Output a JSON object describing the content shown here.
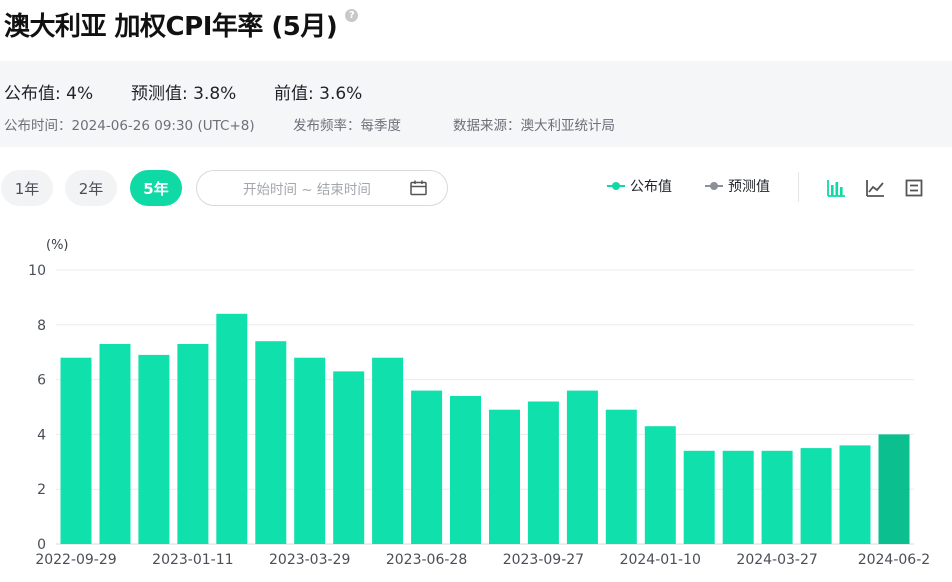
{
  "header": {
    "title": "澳大利亚 加权CPI年率 (5月)",
    "help_icon": "?"
  },
  "stats": {
    "actual": "公布值: 4%",
    "forecast": "预测值: 3.8%",
    "previous": "前值: 3.6%"
  },
  "meta": {
    "release_time": "公布时间：2024-06-26 09:30 (UTC+8)",
    "frequency": "发布频率：每季度",
    "source": "数据来源：澳大利亚统计局"
  },
  "toolbar": {
    "ranges": [
      "1年",
      "2年",
      "5年"
    ],
    "active_range": "5年",
    "date_placeholder": "开始时间 ~ 结束时间",
    "legend_actual": "公布值",
    "legend_forecast": "预测值",
    "view_icons": [
      "bar-chart-icon",
      "line-chart-icon",
      "table-icon"
    ]
  },
  "colors": {
    "accent": "#0fd9a4",
    "bar": "#10e0ab",
    "bar_latest": "#0bbf8e",
    "forecast": "#8a8f98",
    "grid": "#ececec",
    "text_muted": "#6b7079"
  },
  "chart_data": {
    "type": "bar",
    "ylabel": "(%)",
    "ylim": [
      0,
      10
    ],
    "yticks": [
      0,
      2,
      4,
      6,
      8,
      10
    ],
    "grid": true,
    "xtick_labels": [
      "2022-09-29",
      "2023-01-11",
      "2023-03-29",
      "2023-06-28",
      "2023-09-27",
      "2024-01-10",
      "2024-03-27",
      "2024-06-2"
    ],
    "series": [
      {
        "name": "公布值",
        "values": [
          6.8,
          7.3,
          6.9,
          7.3,
          8.4,
          7.4,
          6.8,
          6.3,
          6.8,
          5.6,
          5.4,
          4.9,
          5.2,
          5.6,
          4.9,
          4.3,
          3.4,
          3.4,
          3.4,
          3.5,
          3.6,
          4.0
        ]
      }
    ]
  }
}
